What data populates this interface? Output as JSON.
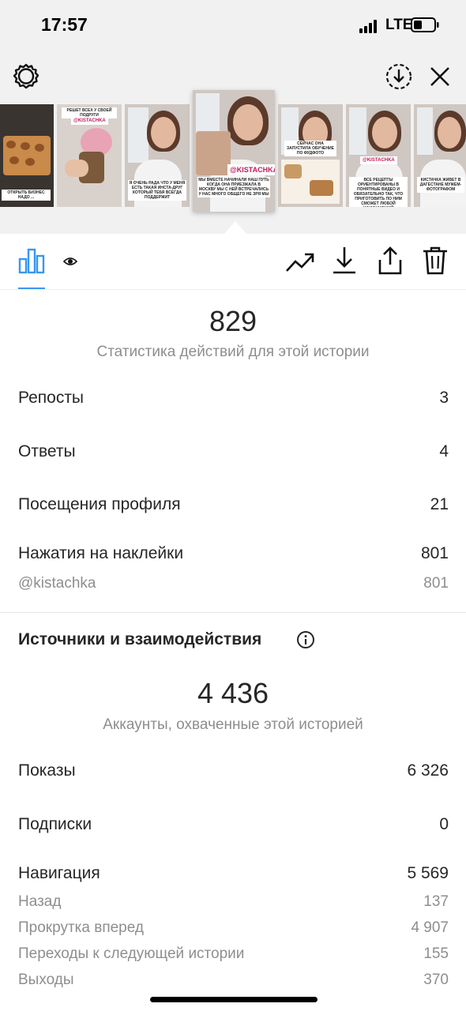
{
  "status_bar": {
    "time": "17:57",
    "network": "LTE"
  },
  "story_thumbs": [
    {
      "caption": "ОТКРЫТЬ БИЗНЕС НАДО ...",
      "tag": ""
    },
    {
      "caption": "РЕШЕТ ВСЕХ У СВОЕЙ ПОДРУГИ",
      "tag": "@KISTACHKA"
    },
    {
      "caption": "Я ОЧЕНЬ РАДА ЧТО У МЕНЯ ЕСТЬ ТАКАЯ ИНСТА-ДРУГ КОТОРЫЙ ТЕБЯ ВСЕГДА ПОДДЕРЖИТ",
      "tag": ""
    },
    {
      "caption": "МЫ ВМЕСТЕ НАЧИНАЛИ НАШ ПУТЬ КОГДА ОНА ПРИЕЗЖАЛА В МОСКВУ МЫ С НЕЙ ВСТРЕЧАЛИСЬ У НАС МНОГО ОБЩЕГО НЕ ЗРЯ МЫ",
      "tag": "@KISTACHKA"
    },
    {
      "caption": "СЕЙЧАС ОНА ЗАПУСТИЛА ОБУЧЕНИЕ ПО ФУДФОТО",
      "tag": ""
    },
    {
      "caption": "ВСЕ РЕЦЕПТЫ ОРИЕНТИРОВАНЫ В ПОНЯТНЫЕ ВИДЕО И ОБЯЗАТЕЛЬНО ТАК, ЧТО ПРИГОТОВИТЬ ПО НИМ СМОЖЕТ ЛЮБОЙ НАЧИНАЮЩИЙ",
      "tag": "@KISTACHKA"
    },
    {
      "caption": "КИСТАЧКА ЖИВЕТ В ДАГЕСТАНЕ МУЖЕМ-ФОТОГРАФОМ",
      "tag": ""
    }
  ],
  "icons": {
    "settings": "gear-icon",
    "download_circle": "download-circle-icon",
    "close": "close-icon",
    "insights": "bar-chart-icon",
    "viewers": "eye-icon",
    "promote": "trend-up-icon",
    "save": "download-icon",
    "share": "share-icon",
    "delete": "trash-icon",
    "info": "info-icon"
  },
  "actions": {
    "total": "829",
    "label": "Статистика действий для этой истории",
    "rows": [
      {
        "label": "Репосты",
        "value": "3"
      },
      {
        "label": "Ответы",
        "value": "4"
      },
      {
        "label": "Посещения профиля",
        "value": "21"
      },
      {
        "label": "Нажатия на наклейки",
        "value": "801"
      }
    ],
    "sticker": {
      "label": "@kistachka",
      "value": "801"
    }
  },
  "discovery": {
    "title": "Источники и взаимодействия",
    "reach": "4 436",
    "reach_label": "Аккаунты, охваченные этой историей",
    "rows": [
      {
        "label": "Показы",
        "value": "6 326"
      },
      {
        "label": "Подписки",
        "value": "0"
      },
      {
        "label": "Навигация",
        "value": "5 569"
      }
    ],
    "navigation": [
      {
        "label": "Назад",
        "value": "137"
      },
      {
        "label": "Прокрутка вперед",
        "value": "4 907"
      },
      {
        "label": "Переходы к следующей истории",
        "value": "155"
      },
      {
        "label": "Выходы",
        "value": "370"
      }
    ]
  },
  "colors": {
    "accent": "#3897f0",
    "text": "#262626",
    "muted": "#8e8e8e"
  }
}
